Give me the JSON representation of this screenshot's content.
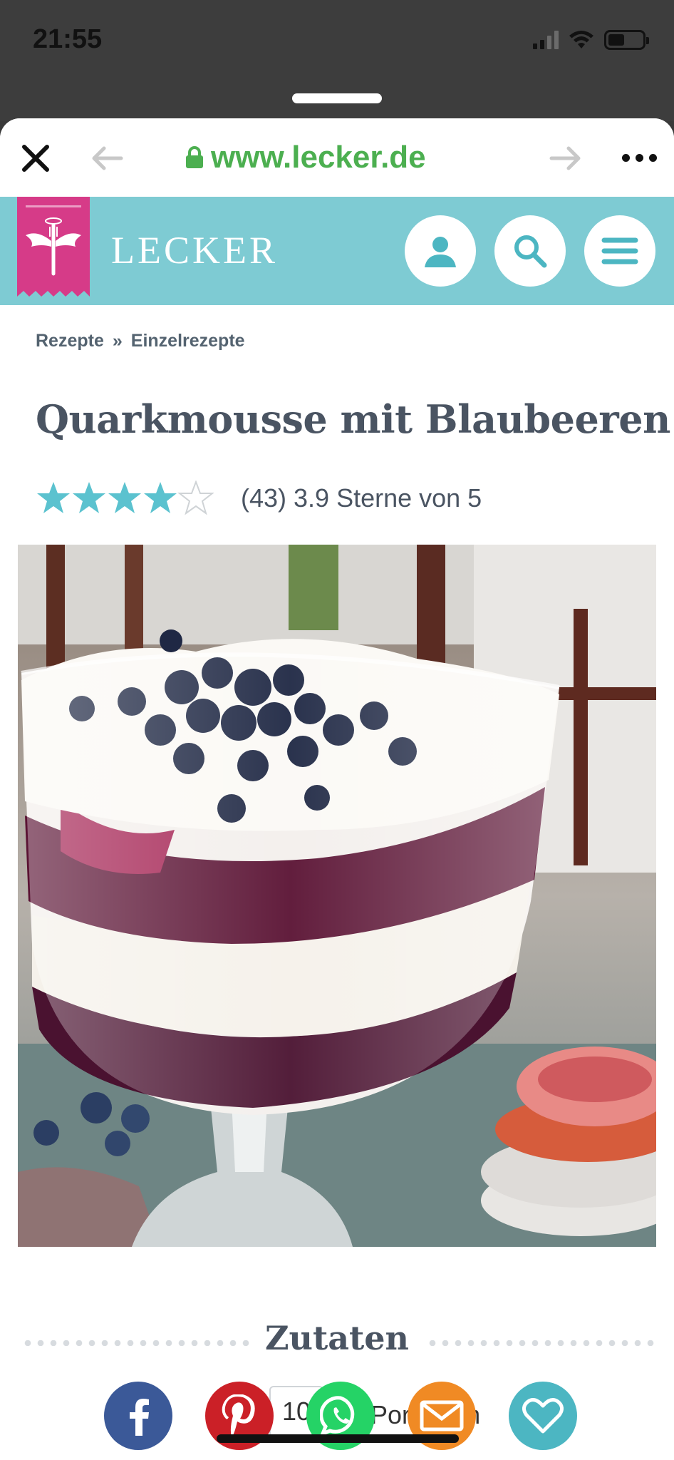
{
  "status": {
    "time": "21:55"
  },
  "browser": {
    "url": "www.lecker.de"
  },
  "site": {
    "brand": "LECKER"
  },
  "breadcrumb": {
    "items": [
      "Rezepte",
      "Einzelrezepte"
    ],
    "separator": "»"
  },
  "recipe": {
    "title": "Quarkmousse mit Blaubeeren",
    "rating": 3.9,
    "rating_text": "(43) 3.9 Sterne von 5",
    "stars_filled": 4,
    "stars_total": 5
  },
  "ingredients": {
    "heading": "Zutaten",
    "portions_value": "10",
    "portions_label": "Portionen"
  },
  "colors": {
    "accent": "#7ecbd3",
    "brand_ribbon": "#d63b88",
    "star": "#5bc2cf",
    "facebook": "#3b5998",
    "pinterest": "#cb2027",
    "whatsapp": "#25d366",
    "mail": "#f08a24",
    "favorite": "#4cb6c2"
  },
  "share": [
    {
      "icon": "facebook-icon"
    },
    {
      "icon": "pinterest-icon"
    },
    {
      "icon": "whatsapp-icon"
    },
    {
      "icon": "mail-icon"
    },
    {
      "icon": "heart-icon"
    }
  ]
}
